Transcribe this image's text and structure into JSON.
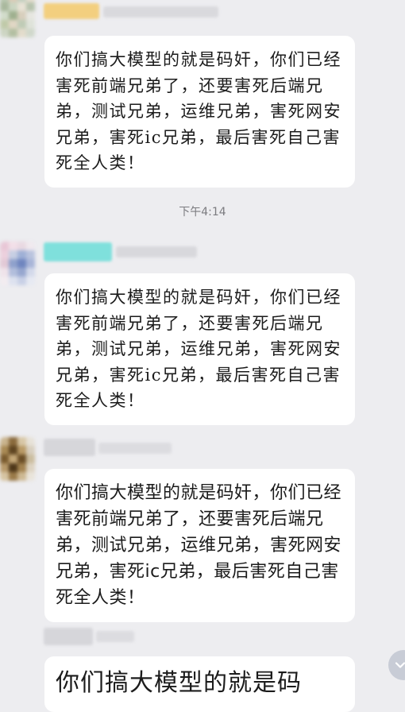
{
  "chat": {
    "timestamp": "下午4:14",
    "messages": [
      {
        "text": "你们搞大模型的就是码奸，你们已经害死前端兄弟了，还要害死后端兄弟，测试兄弟，运维兄弟，害死网安兄弟，害死ic兄弟，最后害死自己害死全人类！"
      },
      {
        "text": "你们搞大模型的就是码奸，你们已经害死前端兄弟了，还要害死后端兄弟，测试兄弟，运维兄弟，害死网安兄弟，害死ic兄弟，最后害死自己害死全人类！"
      },
      {
        "text": "你们搞大模型的就是码奸，你们已经害死前端兄弟了，还要害死后端兄弟，测试兄弟，运维兄弟，害死网安兄弟，害死ic兄弟，最后害死自己害死全人类！"
      },
      {
        "text": "你们搞大模型的就是码"
      }
    ]
  },
  "icons": {
    "scroll_down": "chevron-down-icon"
  },
  "colors": {
    "background": "#ededf0",
    "bubble": "#ffffff",
    "text": "#1b1b1b",
    "timestamp": "#7c7c80"
  }
}
